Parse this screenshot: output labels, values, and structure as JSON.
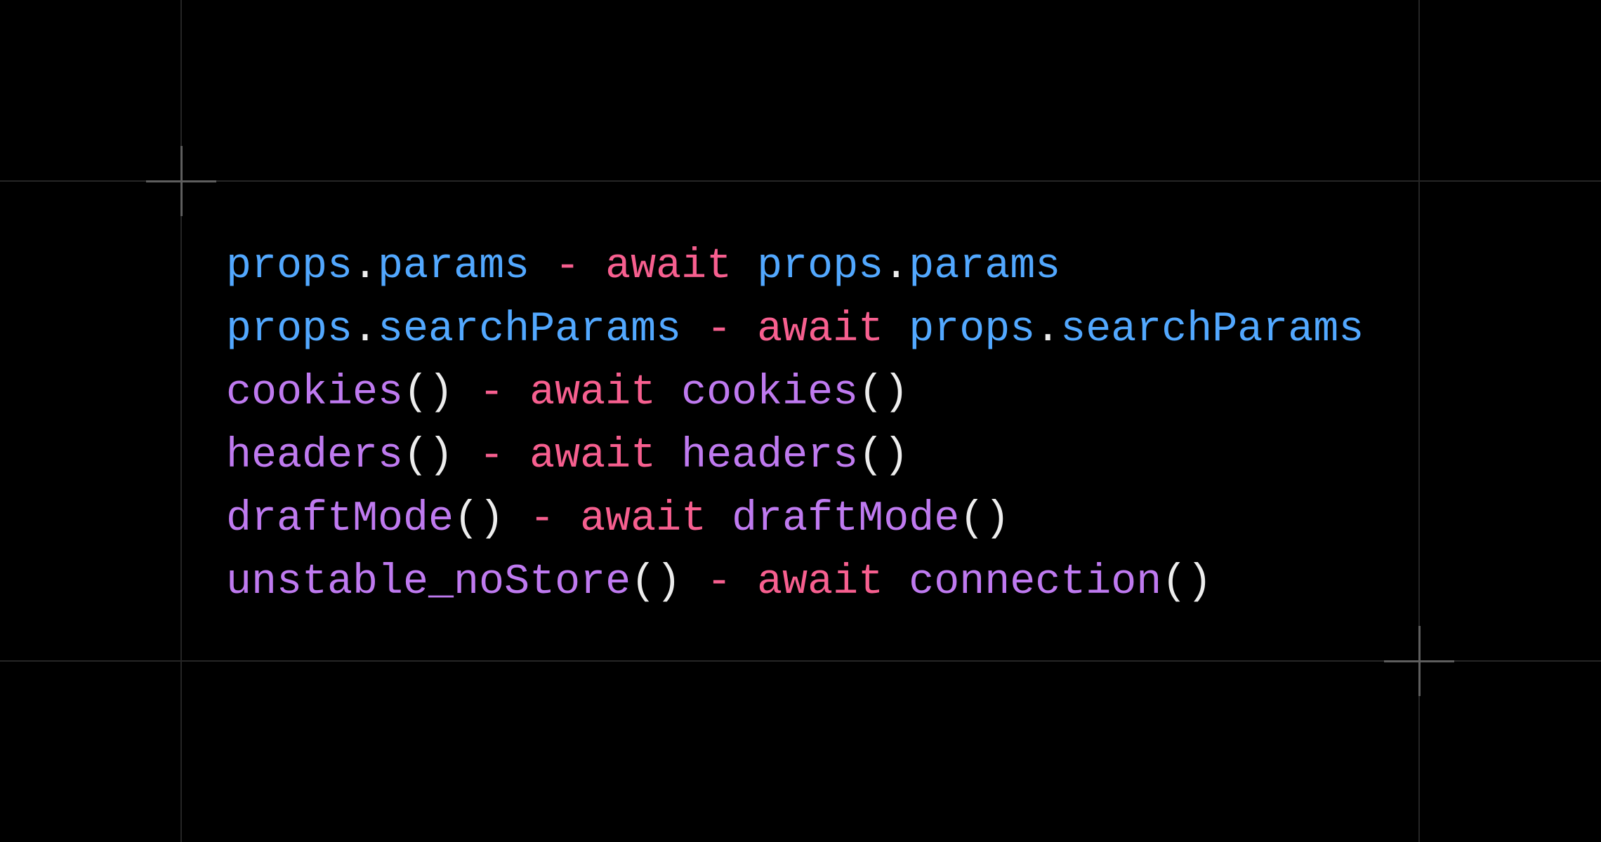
{
  "colors": {
    "background": "#000000",
    "property": "#52a8ff",
    "function": "#bf7af0",
    "keyword": "#f75f8f",
    "punctuation": "#ededed",
    "grid": "#252525",
    "crosshair": "#5e5e5e"
  },
  "code_lines": [
    {
      "tokens": [
        {
          "text": "props",
          "type": "prop"
        },
        {
          "text": ".",
          "type": "punc"
        },
        {
          "text": "params",
          "type": "prop"
        },
        {
          "text": " - ",
          "type": "op"
        },
        {
          "text": "await",
          "type": "kw"
        },
        {
          "text": " ",
          "type": "punc"
        },
        {
          "text": "props",
          "type": "prop"
        },
        {
          "text": ".",
          "type": "punc"
        },
        {
          "text": "params",
          "type": "prop"
        }
      ]
    },
    {
      "tokens": [
        {
          "text": "props",
          "type": "prop"
        },
        {
          "text": ".",
          "type": "punc"
        },
        {
          "text": "searchParams",
          "type": "prop"
        },
        {
          "text": " - ",
          "type": "op"
        },
        {
          "text": "await",
          "type": "kw"
        },
        {
          "text": " ",
          "type": "punc"
        },
        {
          "text": "props",
          "type": "prop"
        },
        {
          "text": ".",
          "type": "punc"
        },
        {
          "text": "searchParams",
          "type": "prop"
        }
      ]
    },
    {
      "tokens": [
        {
          "text": "cookies",
          "type": "fn"
        },
        {
          "text": "()",
          "type": "punc"
        },
        {
          "text": " - ",
          "type": "op"
        },
        {
          "text": "await",
          "type": "kw"
        },
        {
          "text": " ",
          "type": "punc"
        },
        {
          "text": "cookies",
          "type": "fn"
        },
        {
          "text": "()",
          "type": "punc"
        }
      ]
    },
    {
      "tokens": [
        {
          "text": "headers",
          "type": "fn"
        },
        {
          "text": "()",
          "type": "punc"
        },
        {
          "text": " - ",
          "type": "op"
        },
        {
          "text": "await",
          "type": "kw"
        },
        {
          "text": " ",
          "type": "punc"
        },
        {
          "text": "headers",
          "type": "fn"
        },
        {
          "text": "()",
          "type": "punc"
        }
      ]
    },
    {
      "tokens": [
        {
          "text": "draftMode",
          "type": "fn"
        },
        {
          "text": "()",
          "type": "punc"
        },
        {
          "text": " - ",
          "type": "op"
        },
        {
          "text": "await",
          "type": "kw"
        },
        {
          "text": " ",
          "type": "punc"
        },
        {
          "text": "draftMode",
          "type": "fn"
        },
        {
          "text": "()",
          "type": "punc"
        }
      ]
    },
    {
      "tokens": [
        {
          "text": "unstable_noStore",
          "type": "fn"
        },
        {
          "text": "()",
          "type": "punc"
        },
        {
          "text": " - ",
          "type": "op"
        },
        {
          "text": "await",
          "type": "kw"
        },
        {
          "text": " ",
          "type": "punc"
        },
        {
          "text": "connection",
          "type": "fn"
        },
        {
          "text": "()",
          "type": "punc"
        }
      ]
    }
  ]
}
